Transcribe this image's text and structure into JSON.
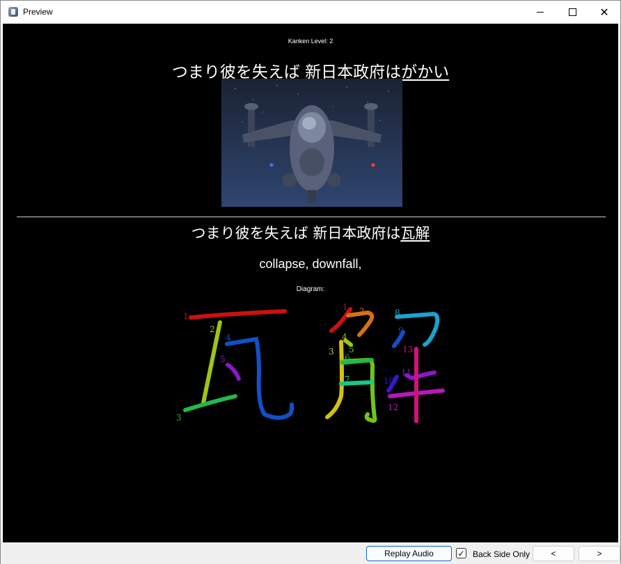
{
  "window": {
    "title": "Preview",
    "controls": {
      "minimize": "—",
      "maximize": "☐",
      "close": "✕"
    }
  },
  "card": {
    "kanken": "Kanken Level: 2",
    "front": {
      "prefix": "つまり彼を失えば 新日本政府は",
      "target": "がかい"
    },
    "back": {
      "prefix": "つまり彼を失えば 新日本政府は",
      "target": "瓦解"
    },
    "meaning": "collapse, downfall,",
    "diagram_label": "Diagram:",
    "stroke_numbers": [
      "1",
      "2",
      "3",
      "4",
      "5",
      "1",
      "2",
      "3",
      "4",
      "5",
      "6",
      "7",
      "8",
      "9",
      "10",
      "11",
      "12",
      "13"
    ]
  },
  "colors": {
    "background": "#000000",
    "text": "#ffffff",
    "accent": "#0a64d6"
  },
  "footer": {
    "replay": "Replay Audio",
    "back_only_label": "Back Side Only",
    "back_only_checked": "✓",
    "prev": "<",
    "next": ">"
  }
}
